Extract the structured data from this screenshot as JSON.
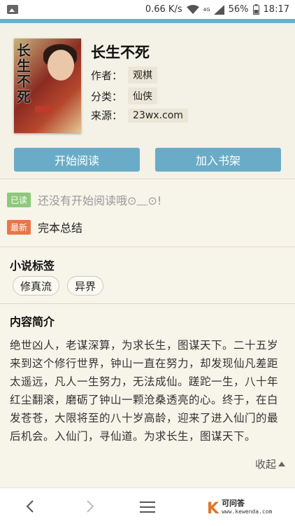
{
  "status_bar": {
    "speed": "0.66 K/s",
    "battery": "56%",
    "time": "18:17",
    "signal_label": "4G"
  },
  "book": {
    "title": "长生不死",
    "cover_title": "长生不死",
    "author_label": "作者：",
    "author": "观棋",
    "category_label": "分类：",
    "category": "仙侠",
    "source_label": "来源：",
    "source": "23wx.com"
  },
  "actions": {
    "start_reading": "开始阅读",
    "add_shelf": "加入书架"
  },
  "progress": {
    "read_tag": "已读",
    "read_text": "还没有开始阅读哦⊙﹏⊙!",
    "latest_tag": "最新",
    "latest_text": "完本总结"
  },
  "tags_section": {
    "title": "小说标签",
    "tags": [
      "修真流",
      "异界"
    ]
  },
  "intro_section": {
    "title": "内容简介",
    "text": "绝世凶人，老谋深算，为求长生，图谋天下。二十五岁来到这个修行世界，钟山一直在努力，却发现仙凡差距太遥远，凡人一生努力，无法成仙。蹉跎一生，八十年红尘翻滚，磨砺了钟山一颗沧桑透亮的心。终于，在白发苍苍，大限将至的八十岁高龄，迎来了进入仙门的最后机会。入仙门，寻仙道。为求长生，图谋天下。",
    "collapse_label": "收起"
  },
  "bottom_nav": {
    "brand_letter": "K",
    "brand_name": "可问答",
    "brand_url": "www.kewenda.com"
  },
  "colors": {
    "accent": "#6aacc7",
    "read_tag": "#8cc97a",
    "latest_tag": "#e8764a",
    "background": "#f7f4ea"
  }
}
